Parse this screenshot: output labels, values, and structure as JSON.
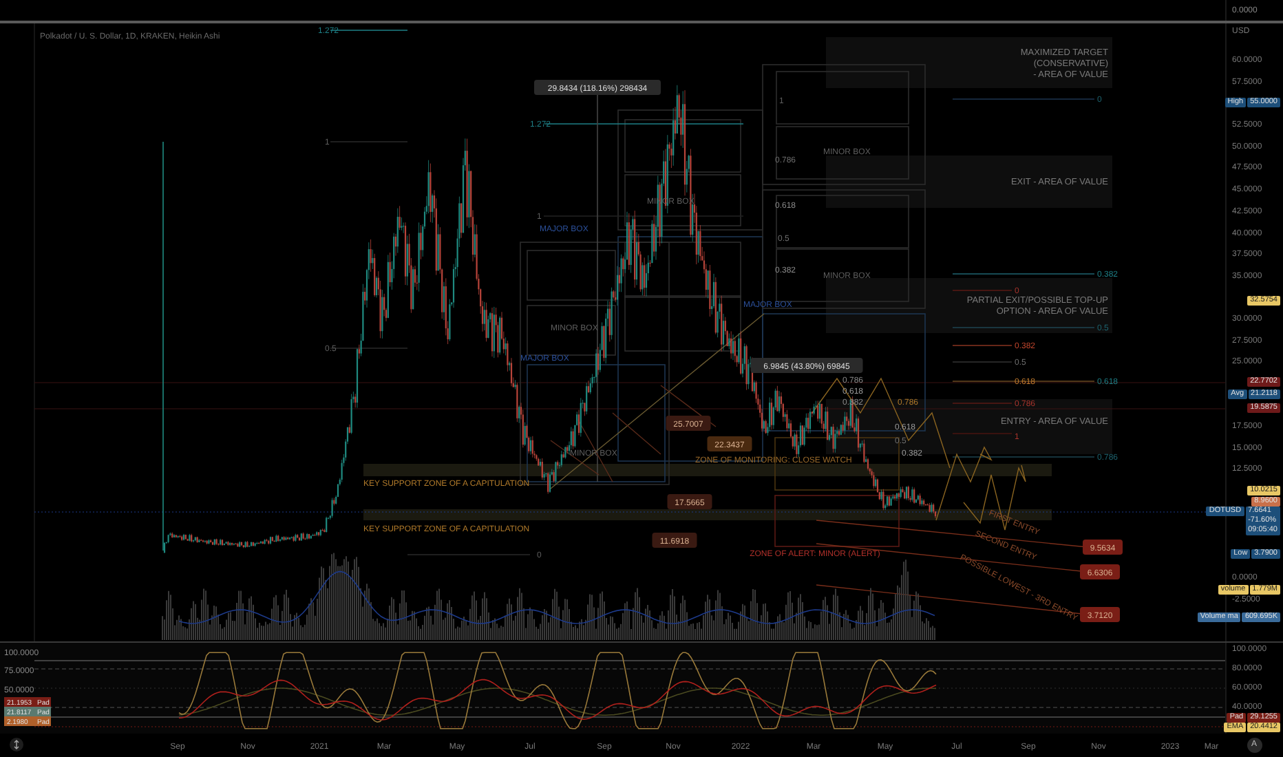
{
  "header": {
    "title": "Polkadot / U. S. Dollar, 1D, KRAKEN, Heikin Ashi",
    "top_axis_label": "0.0000"
  },
  "chart": {
    "annotations": [
      {
        "kind": "label",
        "text": "1.272",
        "color": "#1e7f86"
      },
      {
        "kind": "label",
        "text": "1",
        "color": "#5e5e5e"
      },
      {
        "kind": "label",
        "text": "0.5",
        "color": "#5e5e5e"
      },
      {
        "kind": "label",
        "text": "0",
        "color": "#5e5e5e"
      },
      {
        "kind": "measure",
        "text": "29.8434 (118.16%) 298434",
        "color": "#2a2a2a"
      },
      {
        "kind": "label",
        "text": "1.272",
        "color": "#1e7f86"
      },
      {
        "kind": "label",
        "text": "1",
        "color": "#5e5e5e"
      },
      {
        "kind": "label",
        "text": "MAJOR BOX",
        "color": "#2b4f99"
      },
      {
        "kind": "label",
        "text": "MINOR BOX",
        "color": "#5e5e5e"
      },
      {
        "kind": "label",
        "text": "MINOR BOX",
        "color": "#5e5e5e"
      },
      {
        "kind": "label",
        "text": "MAJOR BOX",
        "color": "#2b4f99"
      },
      {
        "kind": "label",
        "text": "MINOR BOX",
        "color": "#5e5e5e"
      },
      {
        "kind": "label",
        "text": "MAJOR BOX",
        "color": "#2b4f99"
      },
      {
        "kind": "label",
        "text": "1",
        "color": "#5e5e5e"
      },
      {
        "kind": "label",
        "text": "0.786",
        "color": "#6e6e6e"
      },
      {
        "kind": "label",
        "text": "MINOR BOX",
        "color": "#5e5e5e"
      },
      {
        "kind": "label",
        "text": "0.618",
        "color": "#8a8a8a"
      },
      {
        "kind": "label",
        "text": "0.5",
        "color": "#6e6e6e"
      },
      {
        "kind": "label",
        "text": "0.382",
        "color": "#8a8a8a"
      },
      {
        "kind": "label",
        "text": "MINOR BOX",
        "color": "#5e5e5e"
      },
      {
        "kind": "note",
        "lines": [
          "MAXIMIZED TARGET",
          "(CONSERVATIVE)",
          "- AREA OF VALUE"
        ],
        "color": "#7a7a7a"
      },
      {
        "kind": "label",
        "text": "0",
        "color": "#1e6470"
      },
      {
        "kind": "note",
        "lines": [
          "EXIT - AREA OF VALUE"
        ],
        "color": "#7a7a7a"
      },
      {
        "kind": "label",
        "text": "0.382",
        "color": "#1e7f86"
      },
      {
        "kind": "label",
        "text": "0",
        "color": "#a8342c"
      },
      {
        "kind": "note",
        "lines": [
          "PARTIAL EXIT/POSSIBLE TOP-UP",
          "OPTION - AREA OF VALUE"
        ],
        "color": "#7a7a7a"
      },
      {
        "kind": "label",
        "text": "0.5",
        "color": "#1e6470"
      },
      {
        "kind": "label",
        "text": "0.382",
        "color": "#c0452c"
      },
      {
        "kind": "label",
        "text": "0.5",
        "color": "#6e6e6e"
      },
      {
        "kind": "label",
        "text": "0.618",
        "color": "#c07a2c"
      },
      {
        "kind": "label",
        "text": "0.618",
        "color": "#1e7f86"
      },
      {
        "kind": "label",
        "text": "0.786",
        "color": "#a8342c"
      },
      {
        "kind": "note",
        "lines": [
          "ENTRY - AREA OF VALUE"
        ],
        "color": "#7a7a7a"
      },
      {
        "kind": "label",
        "text": "1",
        "color": "#a8342c"
      },
      {
        "kind": "label",
        "text": "0.786",
        "color": "#1e6470"
      },
      {
        "kind": "measure",
        "text": "6.9845 (43.80%) 69845",
        "color": "#2a2a2a"
      },
      {
        "kind": "label",
        "text": "0.786",
        "color": "#8a8a8a"
      },
      {
        "kind": "label",
        "text": "0.618",
        "color": "#9a9a9a"
      },
      {
        "kind": "label",
        "text": "0.382",
        "color": "#8a8a8a"
      },
      {
        "kind": "label",
        "text": "0.786",
        "color": "#b07a2a"
      },
      {
        "kind": "label",
        "text": "0.618",
        "color": "#9a9a9a"
      },
      {
        "kind": "label",
        "text": "0.5",
        "color": "#6e6e6e"
      },
      {
        "kind": "label",
        "text": "0.382",
        "color": "#9a9a9a"
      },
      {
        "kind": "tag",
        "text": "25.7007",
        "color": "#3a1a12"
      },
      {
        "kind": "tag",
        "text": "22.3437",
        "color": "#4a2a10"
      },
      {
        "kind": "tag",
        "text": "17.5665",
        "color": "#3a1a12"
      },
      {
        "kind": "tag",
        "text": "11.6918",
        "color": "#3a1a12"
      },
      {
        "kind": "label",
        "text": "KEY SUPPORT ZONE OF A  CAPITULATION",
        "color": "#b07a2a"
      },
      {
        "kind": "label",
        "text": "KEY SUPPORT ZONE OF A  CAPITULATION",
        "color": "#b07a2a"
      },
      {
        "kind": "label",
        "text": "ZONE OF MONITORING: CLOSE WATCH",
        "color": "#9a6a2a"
      },
      {
        "kind": "label",
        "text": "ZONE OF ALERT: MINOR (ALERT)",
        "color": "#b0302a"
      },
      {
        "kind": "label",
        "text": "FIRST ENTRY",
        "color": "#8a4a2a"
      },
      {
        "kind": "label",
        "text": "SECOND ENTRY",
        "color": "#8a4a2a"
      },
      {
        "kind": "label",
        "text": "POSSIBLE LOWEST - 3RD ENTRY",
        "color": "#8a4a2a"
      },
      {
        "kind": "tag",
        "text": "9.5634",
        "color": "#7a1e16"
      },
      {
        "kind": "tag",
        "text": "6.6306",
        "color": "#7a1e16"
      },
      {
        "kind": "tag",
        "text": "3.7120",
        "color": "#7a1e16"
      }
    ]
  },
  "price_axis": {
    "unit": "USD",
    "ticks": [
      "60.0000",
      "57.5000",
      "52.5000",
      "50.0000",
      "47.5000",
      "45.0000",
      "42.5000",
      "40.0000",
      "37.5000",
      "35.0000",
      "30.0000",
      "27.5000",
      "25.0000",
      "17.5000",
      "15.0000",
      "12.5000",
      "0.0000",
      "-2.5000"
    ],
    "tags": [
      {
        "caption": "High",
        "value": "55.0000",
        "color": "#1d4f7a"
      },
      {
        "value": "32.5754",
        "color": "#e8c765"
      },
      {
        "value": "22.7702",
        "color": "#6e1a1a"
      },
      {
        "caption": "Avg",
        "value": "21.2118",
        "color": "#1d4f7a"
      },
      {
        "value": "19.5875",
        "color": "#6e1a1a"
      },
      {
        "value": "10.0215",
        "color": "#e8c765"
      },
      {
        "value": "8.9600",
        "color": "#c9704a"
      },
      {
        "caption": "DOTUSD",
        "value": "7.6641",
        "extra": [
          "-71.60%",
          "09:05:40"
        ],
        "color": "#1d4f7a"
      },
      {
        "caption": "Low",
        "value": "3.7900",
        "color": "#1d4f7a"
      },
      {
        "caption": "volume",
        "value": "1.779M",
        "color": "#e8c765"
      },
      {
        "caption": "Volume ma",
        "value": "609.695K",
        "color": "#3a6b9a"
      }
    ]
  },
  "oscillator": {
    "left_ticks": [
      "100.0000",
      "75.0000",
      "50.0000"
    ],
    "left_tags": [
      {
        "value": "21.1953",
        "caption": "Pad",
        "color": "#7a1e16"
      },
      {
        "value": "21.8117",
        "caption": "Pad",
        "color": "#5a7a70"
      },
      {
        "value": "2.1980",
        "caption": "Pad",
        "color": "#b0602a"
      }
    ],
    "right_ticks": [
      "100.0000",
      "80.0000",
      "60.0000",
      "40.0000"
    ],
    "right_tags": [
      {
        "caption": "Pad",
        "value": "29.1255",
        "color": "#7a1e16"
      },
      {
        "caption": "EMA",
        "value": "20.4412",
        "color": "#e8c765"
      }
    ]
  },
  "time_axis": {
    "labels": [
      "Sep",
      "Nov",
      "2021",
      "Mar",
      "May",
      "Jul",
      "Sep",
      "Nov",
      "2022",
      "Mar",
      "May",
      "Jul",
      "Sep",
      "Nov",
      "2023",
      "Mar"
    ],
    "auto_button": "A"
  }
}
